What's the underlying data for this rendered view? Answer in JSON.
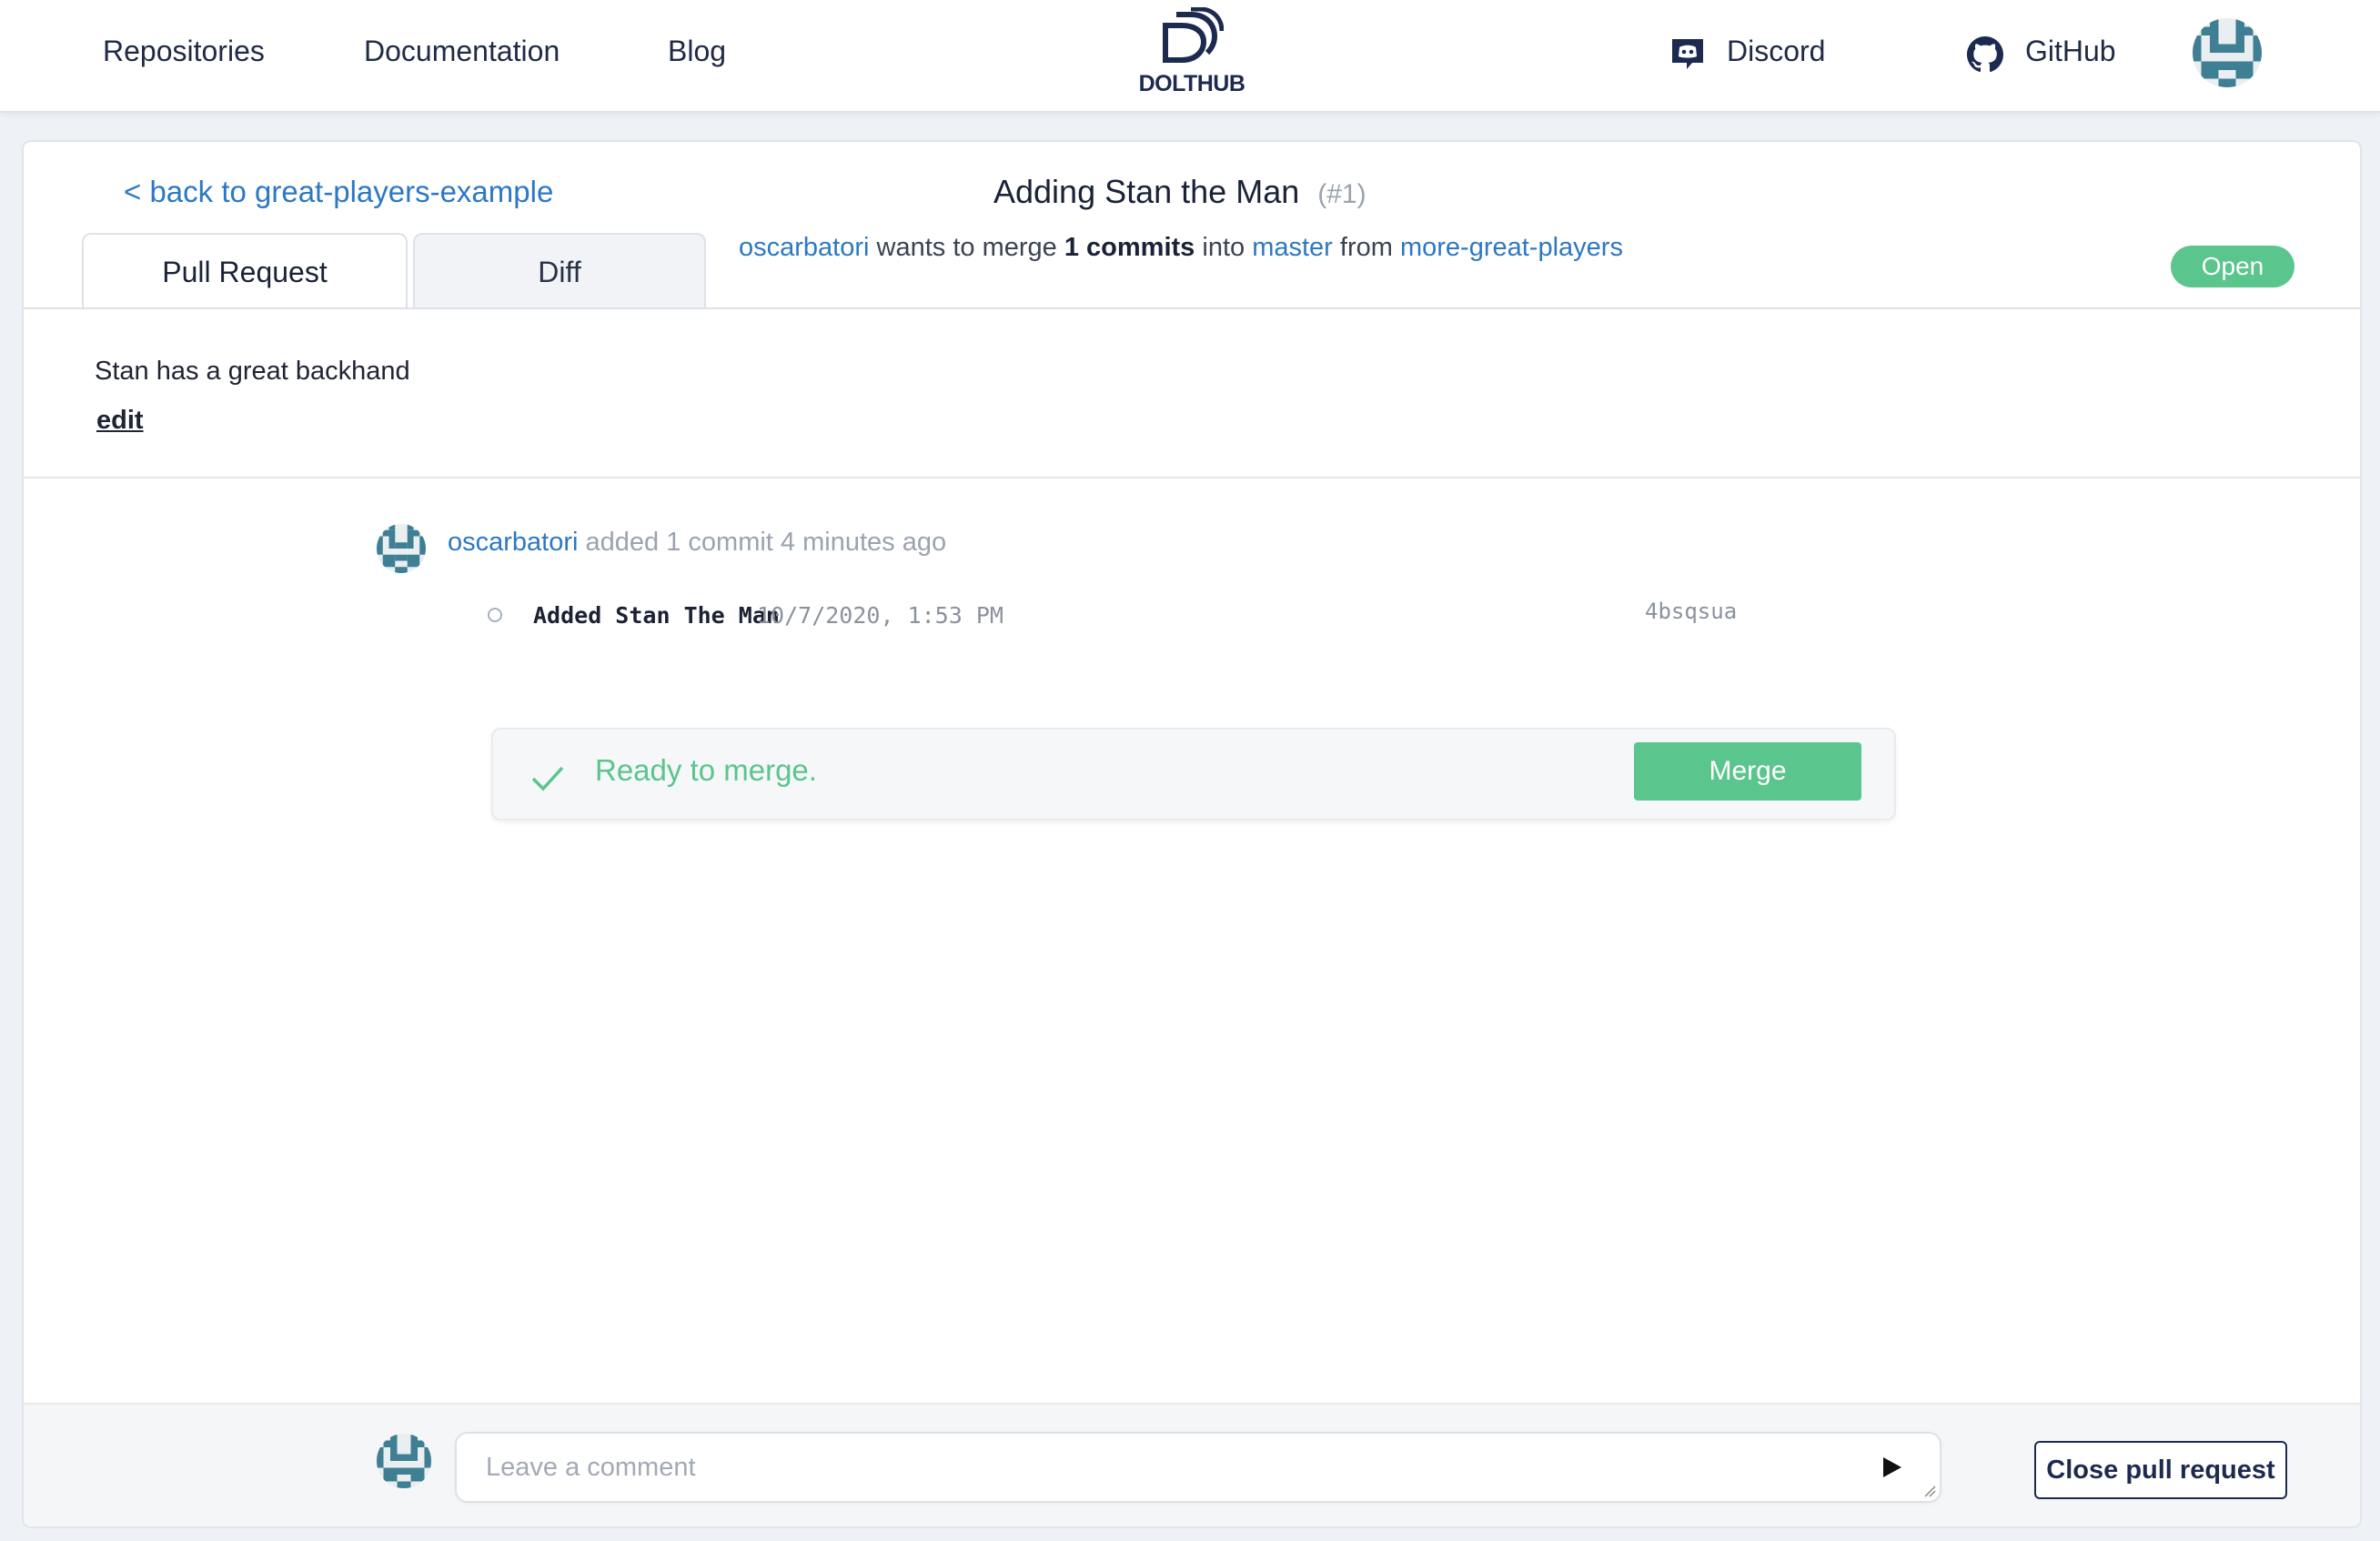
{
  "nav": {
    "links": [
      "Repositories",
      "Documentation",
      "Blog"
    ],
    "brand": "DOLTHUB",
    "discord": "Discord",
    "github": "GitHub"
  },
  "pr": {
    "back_link": "< back to great-players-example",
    "tabs": [
      "Pull Request",
      "Diff"
    ],
    "active_tab": "Pull Request",
    "title": "Adding Stan the Man",
    "number": "(#1)",
    "author": "oscarbatori",
    "meta_wants": "wants to merge",
    "commit_count": "1 commits",
    "meta_into": "into",
    "base_branch": "master",
    "meta_from": "from",
    "head_branch": "more-great-players",
    "status": "Open",
    "description": "Stan has a great backhand",
    "edit_label": "edit"
  },
  "activity": {
    "author": "oscarbatori",
    "text": "added 1 commit 4 minutes ago",
    "commits": [
      {
        "message": "Added Stan The Man",
        "date": "10/7/2020, 1:53 PM",
        "hash": "4bsqsua"
      }
    ]
  },
  "merge": {
    "status": "Ready to merge.",
    "button": "Merge"
  },
  "comment": {
    "placeholder": "Leave a comment",
    "close_button": "Close pull request"
  },
  "colors": {
    "accent_blue": "#2d78c3",
    "success_green": "#5ac58d",
    "navy": "#1c2a4f"
  },
  "icons": [
    "discord-icon",
    "github-icon",
    "dolthub-logo-icon",
    "checkmark-icon",
    "send-icon",
    "avatar-icon"
  ]
}
